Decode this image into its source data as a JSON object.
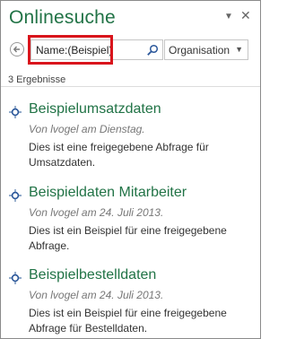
{
  "pane": {
    "title": "Onlinesuche",
    "dropdown_glyph": "▼",
    "close_glyph": "✕"
  },
  "search": {
    "value": "Name:(Beispiel)",
    "scope": "Organisation"
  },
  "results_count": "3 Ergebnisse",
  "results": [
    {
      "title": "Beispielumsatzdaten",
      "meta": "Von lvogel am Dienstag.",
      "description": "Dies ist eine freigegebene Abfrage für Umsatzdaten."
    },
    {
      "title": "Beispieldaten Mitarbeiter",
      "meta": "Von lvogel am 24. Juli 2013.",
      "description": "Dies ist ein Beispiel für eine freigegebene Abfrage."
    },
    {
      "title": "Beispielbestelldaten",
      "meta": "Von lvogel am 24. Juli 2013.",
      "description": "Dies ist ein Beispiel für eine freigegebene Abfrage für Bestelldaten."
    }
  ],
  "colors": {
    "accent": "#217346",
    "highlight": "#d9151c"
  },
  "icons": {
    "back": "back-arrow-icon",
    "search": "magnifier-icon",
    "result": "query-icon"
  }
}
